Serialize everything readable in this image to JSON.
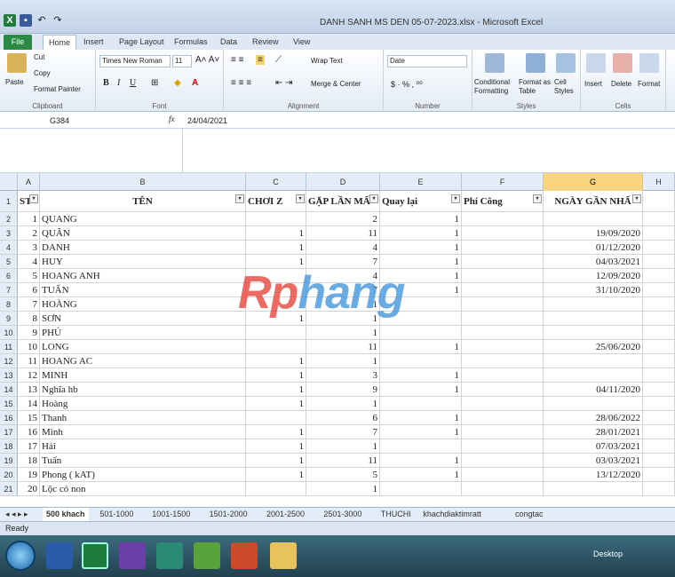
{
  "window": {
    "title": "DANH SANH MS  DEN 05-07-2023.xlsx - Microsoft Excel"
  },
  "tabs": [
    "File",
    "Home",
    "Insert",
    "Page Layout",
    "Formulas",
    "Data",
    "Review",
    "View"
  ],
  "ribbon": {
    "clipboard": {
      "label": "Clipboard",
      "paste": "Paste",
      "cut": "Cut",
      "copy": "Copy",
      "format_painter": "Format Painter"
    },
    "font": {
      "label": "Font",
      "name": "Times New Roman",
      "size": "11"
    },
    "alignment": {
      "label": "Alignment",
      "wrap": "Wrap Text",
      "merge": "Merge & Center"
    },
    "number": {
      "label": "Number",
      "format": "Date"
    },
    "styles": {
      "label": "Styles",
      "conditional": "Conditional Formatting",
      "format_table": "Format as Table",
      "cell_styles": "Cell Styles"
    },
    "cells": {
      "label": "Cells",
      "insert": "Insert",
      "delete": "Delete",
      "format": "Format"
    }
  },
  "formula_bar": {
    "name_box": "G384",
    "fx": "fx",
    "value": "24/04/2021"
  },
  "columns": [
    "A",
    "B",
    "C",
    "D",
    "E",
    "F",
    "G",
    "H"
  ],
  "header_row": {
    "num": "1",
    "a": "ST",
    "b": "TÊN",
    "c": "CHƠI Z",
    "d": "GẶP LẦN MẤ",
    "e": "Quay lại",
    "f": "Phí Công",
    "g": "NGÀY GẦN NHẤ"
  },
  "rows": [
    {
      "n": "2",
      "a": "1",
      "b": "QUANG",
      "c": "",
      "d": "2",
      "e": "1",
      "f": "",
      "g": ""
    },
    {
      "n": "3",
      "a": "2",
      "b": "QUÂN",
      "c": "1",
      "d": "11",
      "e": "1",
      "f": "",
      "g": "19/09/2020"
    },
    {
      "n": "4",
      "a": "3",
      "b": "DANH",
      "c": "1",
      "d": "4",
      "e": "1",
      "f": "",
      "g": "01/12/2020"
    },
    {
      "n": "5",
      "a": "4",
      "b": "HUY",
      "c": "1",
      "d": "7",
      "e": "1",
      "f": "",
      "g": "04/03/2021"
    },
    {
      "n": "6",
      "a": "5",
      "b": "HOANG ANH",
      "c": "",
      "d": "4",
      "e": "1",
      "f": "",
      "g": "12/09/2020"
    },
    {
      "n": "7",
      "a": "6",
      "b": "TUẤN",
      "c": "",
      "d": "7",
      "e": "1",
      "f": "",
      "g": "31/10/2020"
    },
    {
      "n": "8",
      "a": "7",
      "b": "HOÀNG",
      "c": "",
      "d": "1",
      "e": "",
      "f": "",
      "g": ""
    },
    {
      "n": "9",
      "a": "8",
      "b": "SƠN",
      "c": "1",
      "d": "1",
      "e": "",
      "f": "",
      "g": ""
    },
    {
      "n": "10",
      "a": "9",
      "b": "PHÚ",
      "c": "",
      "d": "1",
      "e": "",
      "f": "",
      "g": ""
    },
    {
      "n": "11",
      "a": "10",
      "b": "LONG",
      "c": "",
      "d": "11",
      "e": "1",
      "f": "",
      "g": "25/06/2020"
    },
    {
      "n": "12",
      "a": "11",
      "b": "HOANG AC",
      "c": "1",
      "d": "1",
      "e": "",
      "f": "",
      "g": ""
    },
    {
      "n": "13",
      "a": "12",
      "b": "MINH",
      "c": "1",
      "d": "3",
      "e": "1",
      "f": "",
      "g": ""
    },
    {
      "n": "14",
      "a": "13",
      "b": "Nghĩa  hb",
      "c": "1",
      "d": "9",
      "e": "1",
      "f": "",
      "g": "04/11/2020"
    },
    {
      "n": "15",
      "a": "14",
      "b": "Hoàng",
      "c": "1",
      "d": "1",
      "e": "",
      "f": "",
      "g": ""
    },
    {
      "n": "16",
      "a": "15",
      "b": "Thanh",
      "c": "",
      "d": "6",
      "e": "1",
      "f": "",
      "g": "28/06/2022"
    },
    {
      "n": "17",
      "a": "16",
      "b": "Minh",
      "c": "1",
      "d": "7",
      "e": "1",
      "f": "",
      "g": "28/01/2021"
    },
    {
      "n": "18",
      "a": "17",
      "b": "Hải",
      "c": "1",
      "d": "1",
      "e": "",
      "f": "",
      "g": "07/03/2021"
    },
    {
      "n": "19",
      "a": "18",
      "b": "Tuấn",
      "c": "1",
      "d": "11",
      "e": "1",
      "f": "",
      "g": "03/03/2021"
    },
    {
      "n": "20",
      "a": "19",
      "b": "Phong ( kAT)",
      "c": "1",
      "d": "5",
      "e": "1",
      "f": "",
      "g": "13/12/2020"
    },
    {
      "n": "21",
      "a": "20",
      "b": "Lộc cỏ non",
      "c": "",
      "d": "1",
      "e": "",
      "f": "",
      "g": ""
    }
  ],
  "sheet_tabs": [
    "500 khach",
    "501-1000",
    "1001-1500",
    "1501-2000",
    "2001-2500",
    "2501-3000",
    "THUCHI",
    "khachdiaktimratt",
    "congtac"
  ],
  "status": "Ready",
  "taskbar": {
    "desktop": "Desktop"
  },
  "watermark": {
    "part1": "Rp",
    "part2": "hang"
  }
}
